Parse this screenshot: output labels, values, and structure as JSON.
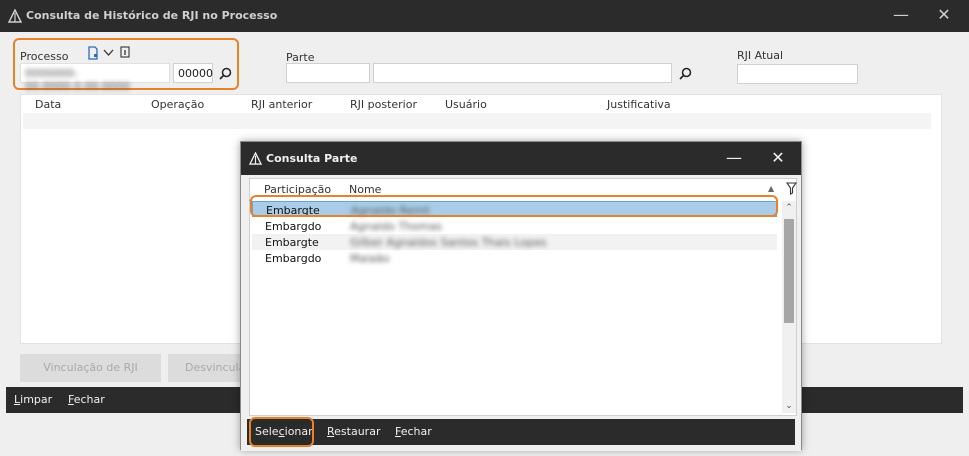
{
  "main_window": {
    "title": "Consulta de Histórico de RJI no Processo",
    "minimize_glyph": "—",
    "close_glyph": "✕"
  },
  "form": {
    "processo_label": "Processo",
    "processo_number_blurred": "0000000-00.0000.0.00.0000",
    "processo_suffix": "00000",
    "parte_label": "Parte",
    "parte_code": "",
    "parte_name": "",
    "rji_atual_label": "RJI Atual",
    "rji_atual_value": ""
  },
  "history_grid": {
    "columns": [
      "Data",
      "Operação",
      "RJI anterior",
      "RJI posterior",
      "Usuário",
      "Justificativa"
    ]
  },
  "actions": {
    "vinculacao": "Vinculação de RJI",
    "desvinculacao": "Desvincula"
  },
  "main_bar": {
    "limpar_first": "L",
    "limpar_rest": "impar",
    "fechar_first": "F",
    "fechar_rest": "echar"
  },
  "dialog": {
    "title": "Consulta Parte",
    "minimize_glyph": "—",
    "close_glyph": "✕",
    "columns": [
      "Participação",
      "Nome"
    ],
    "rows": [
      {
        "participacao": "Embargte",
        "nome": "Agnaldo Reinil"
      },
      {
        "participacao": "Embargdo",
        "nome": "Agnaldo Thomas"
      },
      {
        "participacao": "Embargte",
        "nome": "Gilber Agnaldos Santos Thais Lopes"
      },
      {
        "participacao": "Embargdo",
        "nome": "Maiaão"
      }
    ],
    "bar": {
      "selecionar_pre": "Sele",
      "selecionar_u": "c",
      "selecionar_post": "ionar",
      "restaurar_first": "R",
      "restaurar_rest": "estaurar",
      "fechar_first": "F",
      "fechar_rest": "echar"
    }
  },
  "colors": {
    "highlight": "#e8822a",
    "titlebar": "#2b2b2b",
    "selected_row": "#a9cde9"
  }
}
